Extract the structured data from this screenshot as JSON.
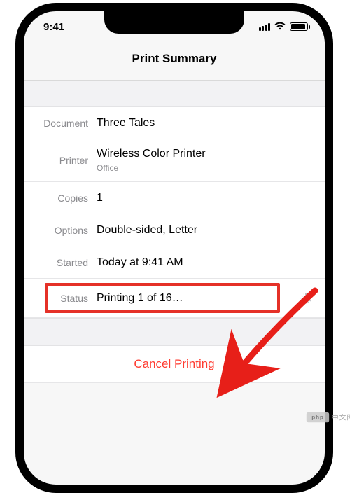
{
  "status_bar": {
    "time": "9:41"
  },
  "header": {
    "title": "Print Summary"
  },
  "rows": {
    "document": {
      "label": "Document",
      "value": "Three Tales"
    },
    "printer": {
      "label": "Printer",
      "value": "Wireless Color Printer",
      "sub": "Office"
    },
    "copies": {
      "label": "Copies",
      "value": "1"
    },
    "options": {
      "label": "Options",
      "value": "Double-sided, Letter"
    },
    "started": {
      "label": "Started",
      "value": "Today at 9:41 AM"
    },
    "status": {
      "label": "Status",
      "value": "Printing 1 of 16…"
    }
  },
  "cancel": {
    "label": "Cancel Printing"
  },
  "watermark": {
    "text": "中文网"
  },
  "colors": {
    "accent_red": "#ff3b30",
    "highlight": "#e53128"
  }
}
